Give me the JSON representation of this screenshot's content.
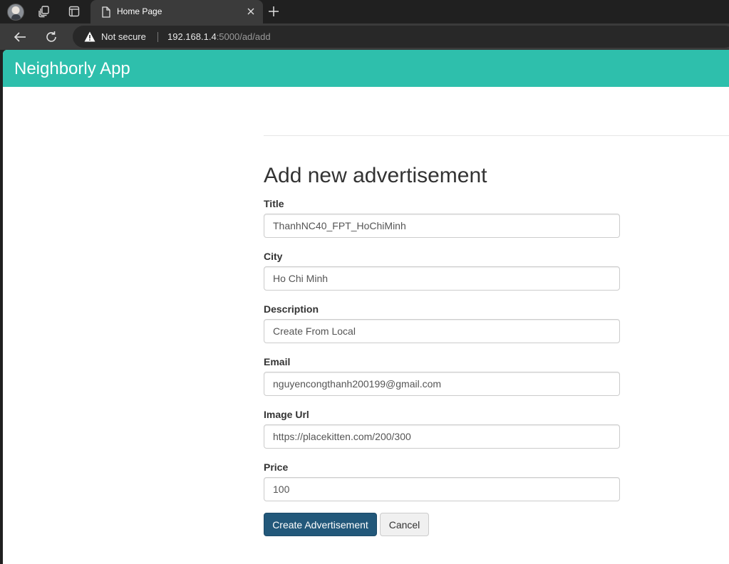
{
  "browser": {
    "tab_title": "Home Page",
    "security_label": "Not secure",
    "url_host": "192.168.1.4",
    "url_rest": ":5000/ad/add"
  },
  "app": {
    "brand": "Neighborly App"
  },
  "form": {
    "heading": "Add new advertisement",
    "fields": [
      {
        "label": "Title",
        "value": "ThanhNC40_FPT_HoChiMinh"
      },
      {
        "label": "City",
        "value": "Ho Chi Minh"
      },
      {
        "label": "Description",
        "value": "Create From Local"
      },
      {
        "label": "Email",
        "value": "nguyencongthanh200199@gmail.com"
      },
      {
        "label": "Image Url",
        "value": "https://placekitten.com/200/300"
      },
      {
        "label": "Price",
        "value": "100"
      }
    ],
    "submit_label": "Create Advertisement",
    "cancel_label": "Cancel"
  },
  "colors": {
    "navbar": "#2ebfac",
    "primary_button": "#22587a"
  }
}
